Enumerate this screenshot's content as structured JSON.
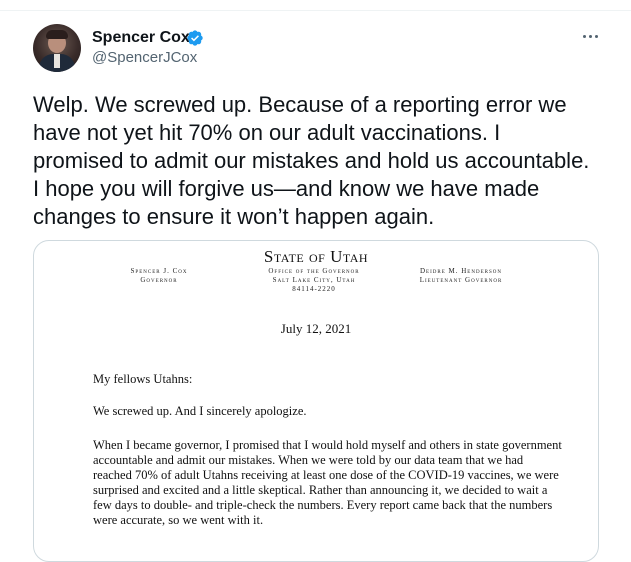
{
  "author": {
    "name": "Spencer Cox",
    "handle": "@SpencerJCox",
    "verified": true,
    "accent_color": "#1d9bf0"
  },
  "tweet": {
    "text": "Welp. We screwed up. Because of a reporting error we have not yet hit 70% on our adult vaccinations. I promised to admit our mistakes and hold us accountable. I hope you will forgive us—and know we have made changes to ensure it won’t happen again."
  },
  "letter": {
    "header_title": "State of Utah",
    "left_name": "Spencer J. Cox",
    "left_title": "Governor",
    "center_line1": "Office of the Governor",
    "center_line2": "Salt Lake City, Utah",
    "center_line3": "84114-2220",
    "right_name": "Deidre M. Henderson",
    "right_title": "Lieutenant Governor",
    "date": "July 12, 2021",
    "salutation": "My fellows Utahns:",
    "apology": "We screwed up. And I sincerely apologize.",
    "body": "When I became governor, I promised that I would hold myself and others in state government accountable and admit our mistakes. When we were told by our data team that we had reached 70% of adult Utahns receiving at least one dose of the COVID-19 vaccines, we were surprised and excited and a little skeptical. Rather than announcing it, we decided to wait a few days to double- and triple-check the numbers. Every report came back that the numbers were accurate, so we went with it."
  }
}
